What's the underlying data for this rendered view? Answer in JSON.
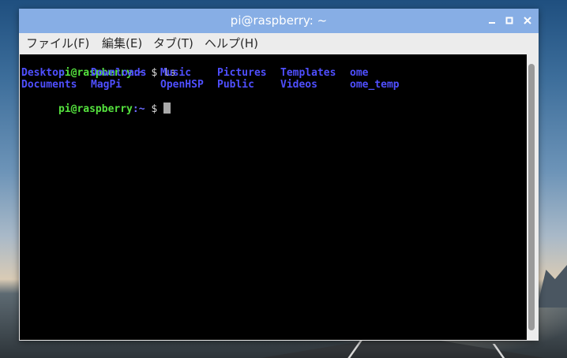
{
  "window": {
    "title": "pi@raspberry: ~"
  },
  "menubar": {
    "items": [
      {
        "label": "ファイル(F)"
      },
      {
        "label": "編集(E)"
      },
      {
        "label": "タブ(T)"
      },
      {
        "label": "ヘルプ(H)"
      }
    ]
  },
  "terminal": {
    "line1": {
      "user_host": "pi@raspberry",
      "path": ":~",
      "symbol": " $ ",
      "command": "ls"
    },
    "listing": {
      "row1": [
        "Desktop",
        "Downloads",
        "Music",
        "Pictures",
        "Templates",
        "ome"
      ],
      "row2": [
        "Documents",
        "MagPi",
        "OpenHSP",
        "Public",
        "Videos",
        "ome_temp"
      ]
    },
    "line3": {
      "user_host": "pi@raspberry",
      "path": ":~",
      "symbol": " $ "
    }
  },
  "colors": {
    "titlebar": "#87aee5",
    "prompt_user": "#55e23e",
    "prompt_path": "#6b6bff",
    "directory": "#4f4fff",
    "terminal_bg": "#000000"
  },
  "icons": {
    "minimize": "minimize-icon",
    "maximize": "maximize-icon",
    "close": "close-icon"
  }
}
